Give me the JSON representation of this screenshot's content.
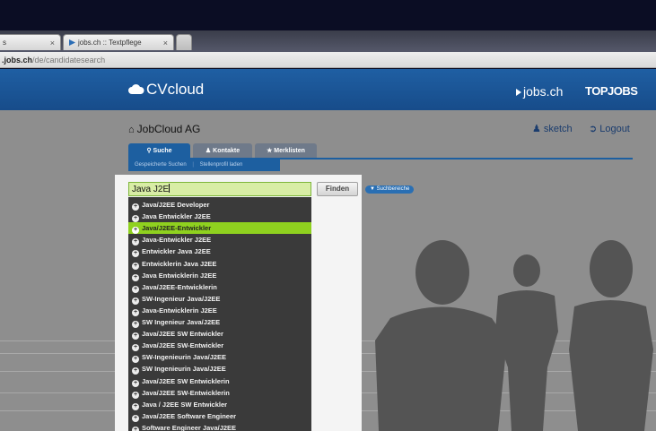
{
  "browser": {
    "tabs": [
      {
        "label": "s",
        "close": "×"
      },
      {
        "label": "jobs.ch :: Textpflege",
        "close": "×"
      }
    ],
    "url_host": ".jobs.ch",
    "url_path": "/de/candidatesearch"
  },
  "header": {
    "logo": "CVcloud",
    "partner_logo": "jobs.ch",
    "partner_logo2": "TOPJOBS"
  },
  "account": {
    "company": "JobCloud AG",
    "user": "sketch",
    "logout": "Logout"
  },
  "nav": {
    "tabs": [
      "Suche",
      "Kontakte",
      "Merklisten"
    ],
    "subnav": [
      "Gespeicherte Suchen",
      "Stellenprofil laden"
    ]
  },
  "search": {
    "value": "Java J2E",
    "find_label": "Finden",
    "check_label": "Suchbereiche",
    "suggestions": [
      "Java/J2EE Developer",
      "Java Entwickler J2EE",
      "Java/J2EE-Entwickler",
      "Java-Entwickler J2EE",
      "Entwickler Java J2EE",
      "Entwicklerin Java J2EE",
      "Java Entwicklerin J2EE",
      "Java/J2EE-Entwicklerin",
      "SW-Ingenieur Java/J2EE",
      "Java-Entwicklerin J2EE",
      "SW Ingenieur Java/J2EE",
      "Java/J2EE SW Entwickler",
      "Java/J2EE SW-Entwickler",
      "SW-Ingenieurin Java/J2EE",
      "SW Ingenieurin Java/J2EE",
      "Java/J2EE SW Entwicklerin",
      "Java/J2EE SW-Entwicklerin",
      "Java / J2EE SW Entwickler",
      "Java/J2EE Software Engineer",
      "Software Engineer Java/J2EE"
    ],
    "highlighted_index": 2
  },
  "colors": {
    "header_blue": "#1f5fa3",
    "highlight_green": "#8fd11f",
    "input_green": "#d8eda5"
  }
}
